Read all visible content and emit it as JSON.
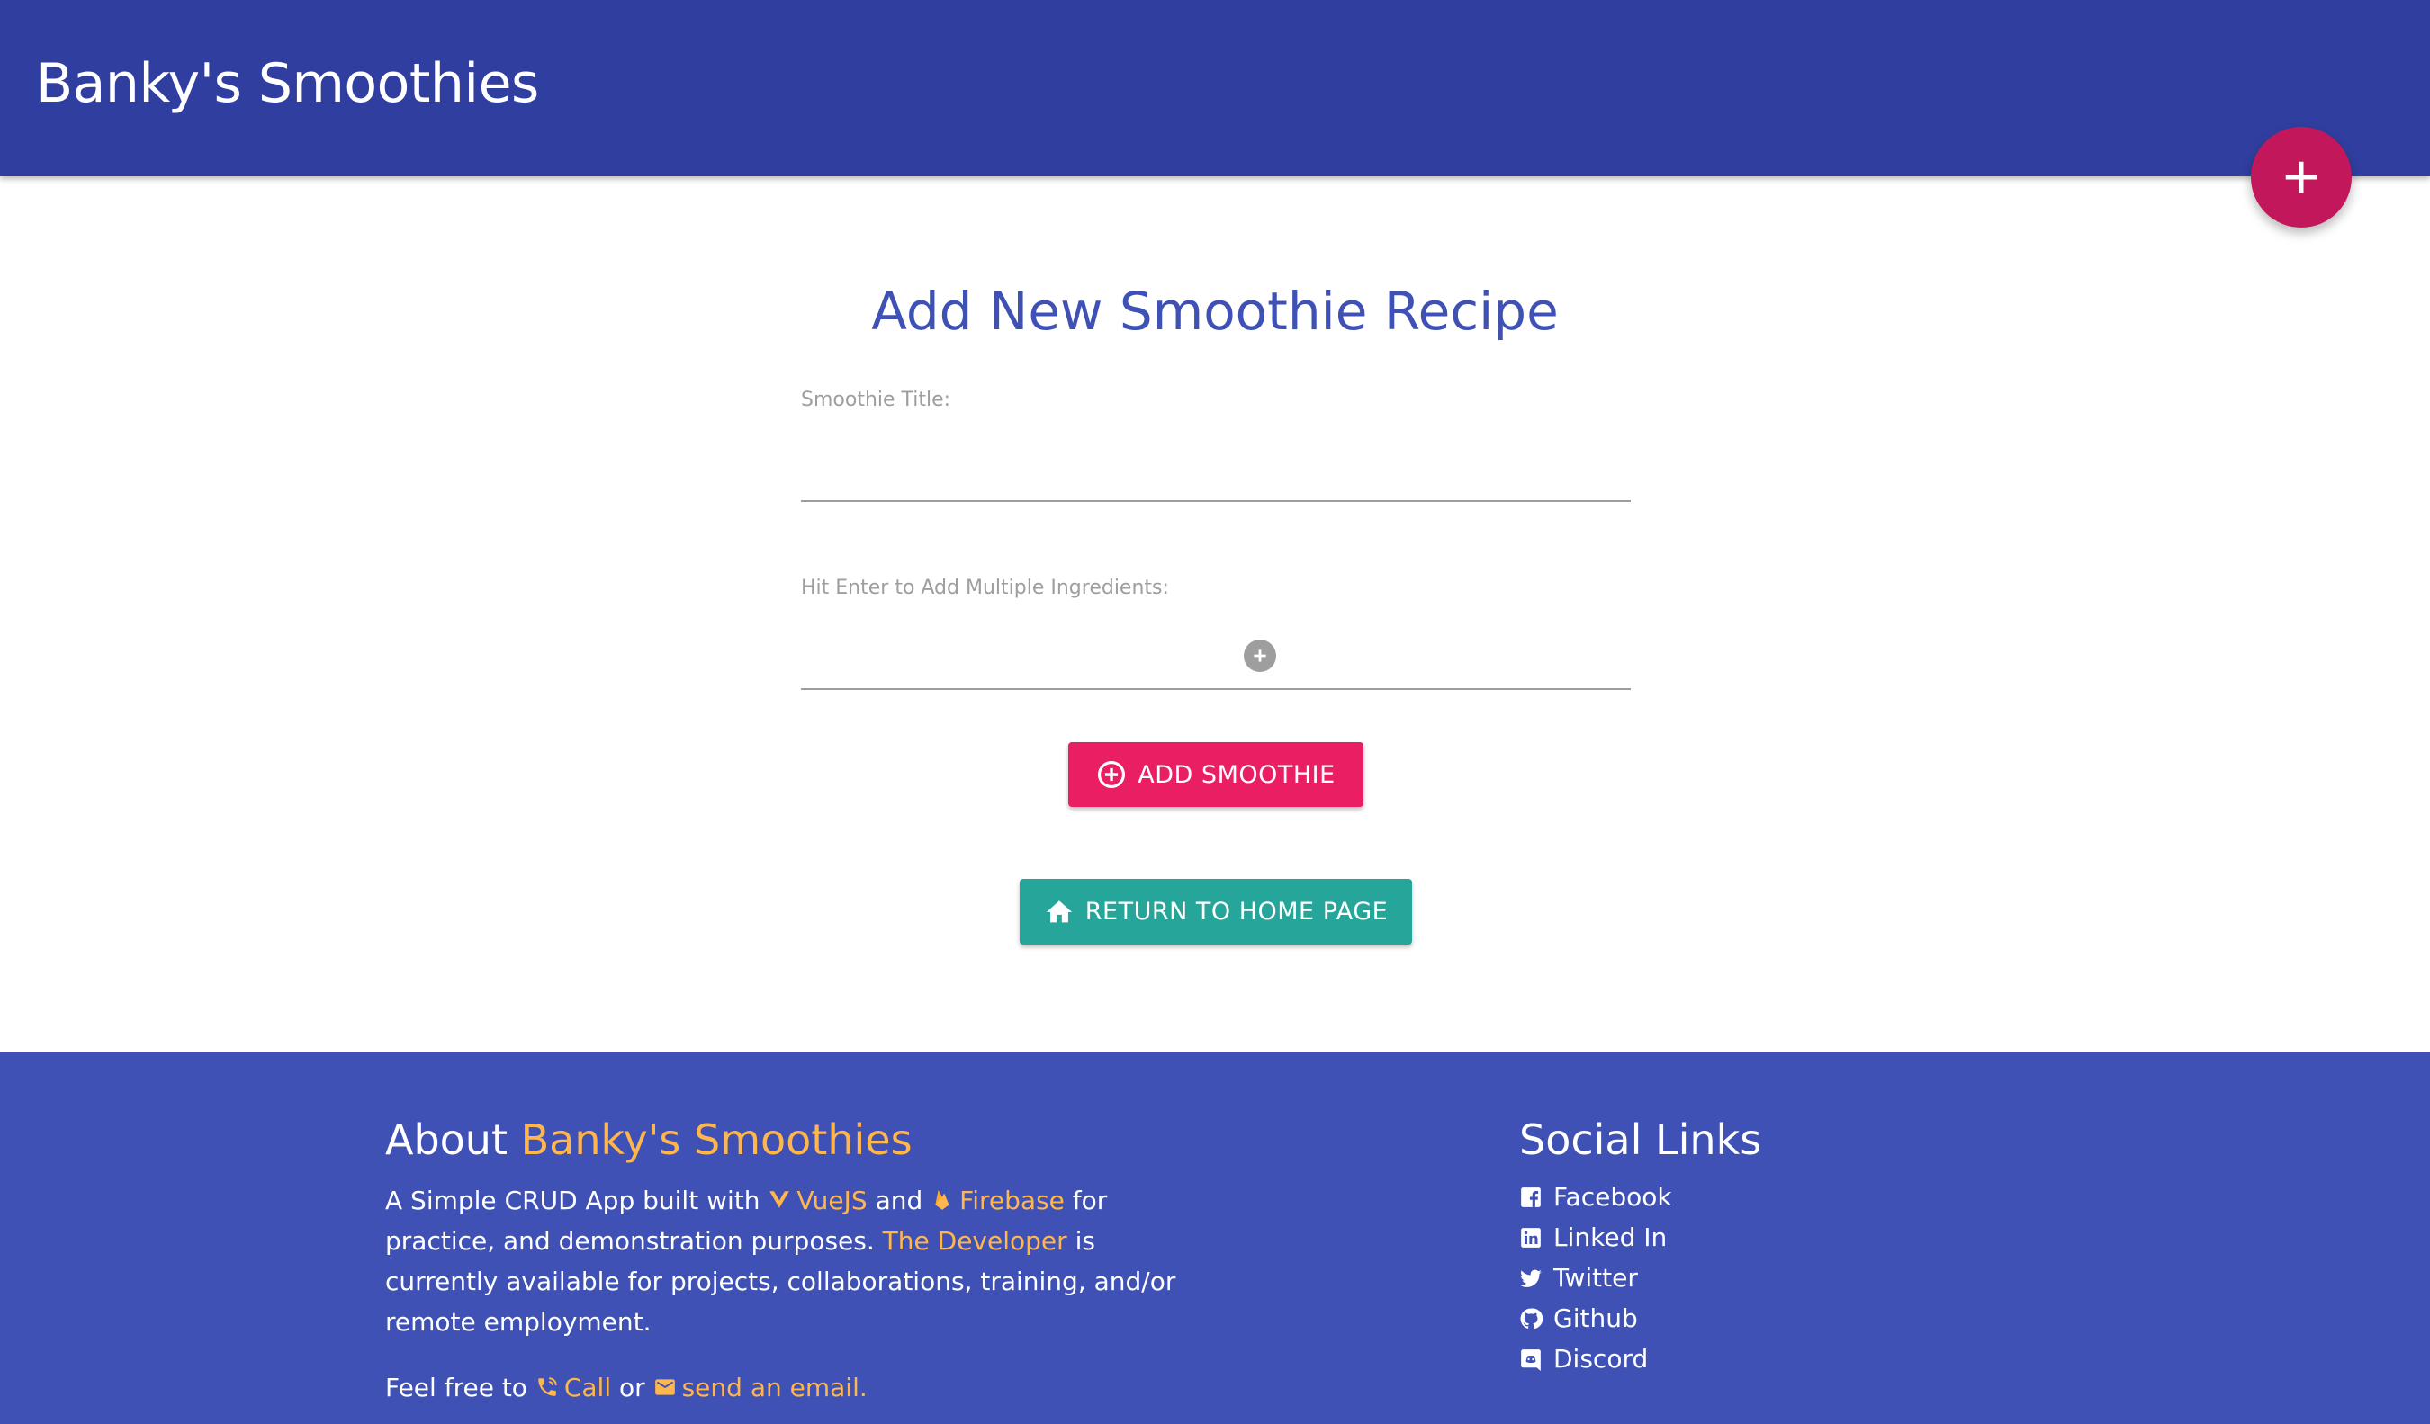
{
  "header": {
    "title": "Banky's Smoothies",
    "fab_icon": "plus-icon"
  },
  "main": {
    "heading": "Add New Smoothie Recipe",
    "title_field": {
      "label": "Smoothie Title:",
      "value": "",
      "placeholder": ""
    },
    "ingredient_field": {
      "label": "Hit Enter to Add Multiple Ingredients:",
      "value": "",
      "placeholder": "",
      "add_icon": "plus-circle-icon"
    },
    "add_button": {
      "label": "Add Smoothie",
      "icon": "plus-circle-outline-icon"
    },
    "home_button": {
      "label": "Return to Home Page",
      "icon": "home-icon"
    }
  },
  "footer": {
    "about": {
      "heading_prefix": "About",
      "heading_brand": "Banky's Smoothies",
      "text_1": "A Simple CRUD App built with",
      "vue_label": "VueJS",
      "text_2": "and",
      "firebase_label": "Firebase",
      "text_3": "for practice, and demonstration purposes.",
      "developer_label": "The Developer",
      "text_4": "is currently available for projects, collaborations, training, and/or remote employment.",
      "contact_prefix": "Feel free to",
      "call_label": "Call",
      "contact_or": "or",
      "email_label": "send an email."
    },
    "social": {
      "heading": "Social Links",
      "links": [
        {
          "label": "Facebook",
          "icon": "facebook-icon"
        },
        {
          "label": "Linked In",
          "icon": "linkedin-icon"
        },
        {
          "label": "Twitter",
          "icon": "twitter-icon"
        },
        {
          "label": "Github",
          "icon": "github-icon"
        },
        {
          "label": "Discord",
          "icon": "discord-icon"
        }
      ]
    }
  },
  "colors": {
    "header": "#303f9f",
    "fab": "#c2185b",
    "heading": "#3f51b5",
    "add_button": "#e91e63",
    "home_button": "#26a69a",
    "footer": "#3f51b5",
    "accent": "#ffb74d"
  }
}
